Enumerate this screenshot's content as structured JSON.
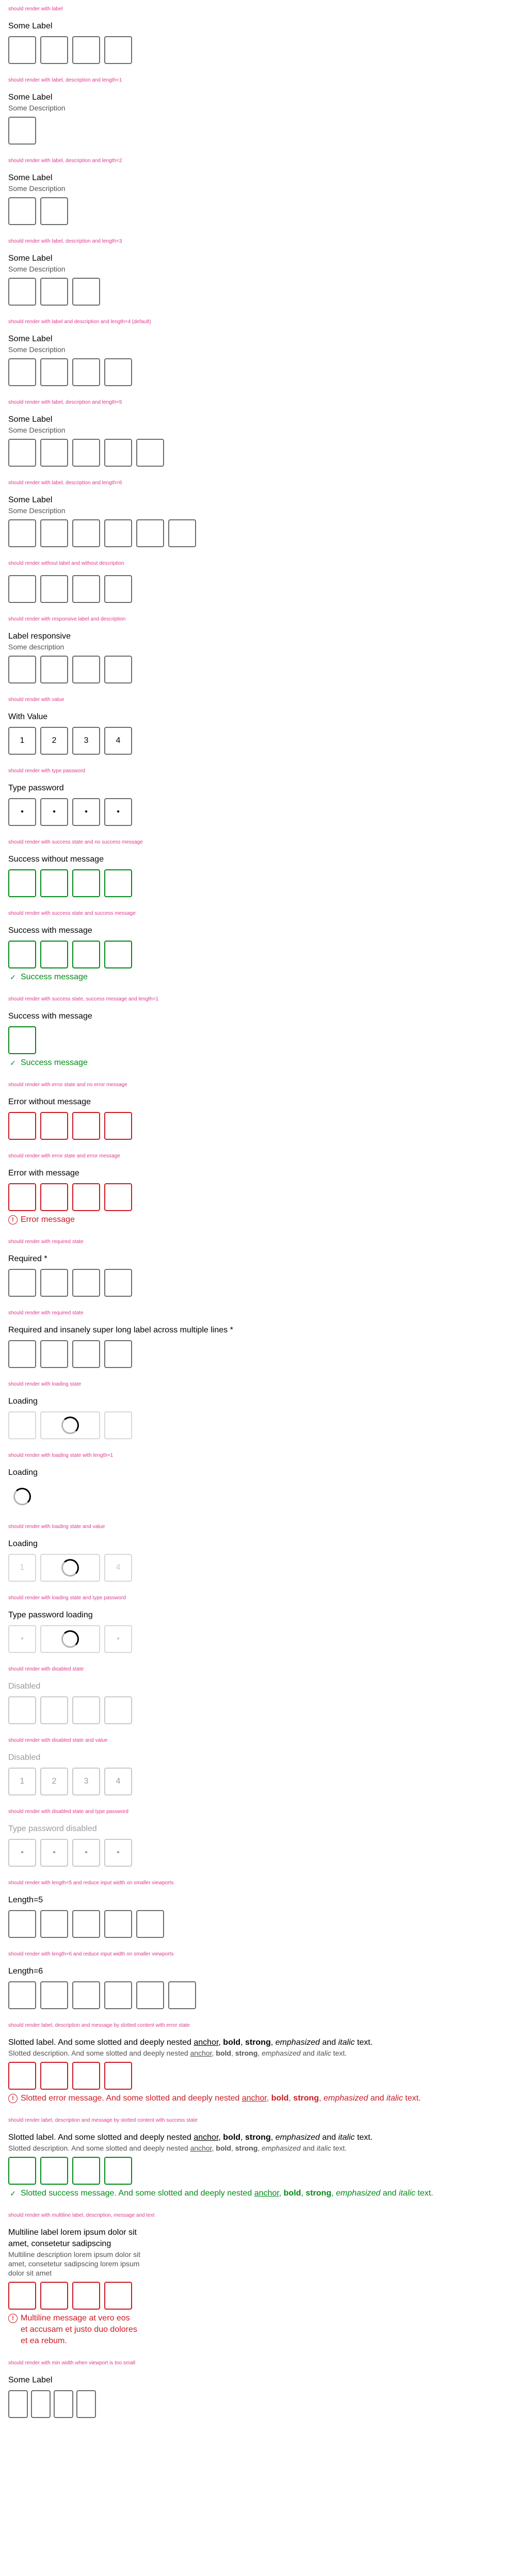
{
  "cases": {
    "c1": {
      "title": "should render with label",
      "label": "Some Label"
    },
    "c2": {
      "title": "should render with label, description and length=1",
      "label": "Some Label",
      "desc": "Some Description"
    },
    "c3": {
      "title": "should render with label, description and length=2",
      "label": "Some Label",
      "desc": "Some Description"
    },
    "c4": {
      "title": "should render with label, description and length=3",
      "label": "Some Label",
      "desc": "Some Description"
    },
    "c5": {
      "title": "should render with label and description and length=4 (default)",
      "label": "Some Label",
      "desc": "Some Description"
    },
    "c6": {
      "title": "should render with label, description and length=5",
      "label": "Some Label",
      "desc": "Some Description"
    },
    "c7": {
      "title": "should render with label, description and length=6",
      "label": "Some Label",
      "desc": "Some Description"
    },
    "c8": {
      "title": "should render without label and without description"
    },
    "c9": {
      "title": "should render with responsive label and description",
      "label": "Label responsive",
      "desc": "Some description"
    },
    "c10": {
      "title": "should render with value",
      "label": "With Value",
      "values": [
        "1",
        "2",
        "3",
        "4"
      ]
    },
    "c11": {
      "title": "should render with type password",
      "label": "Type password",
      "values": [
        "•",
        "•",
        "•",
        "•"
      ]
    },
    "c12": {
      "title": "should render with success state and no success message",
      "label": "Success without message"
    },
    "c13": {
      "title": "should render with success state and success message",
      "label": "Success with message",
      "message": "Success message"
    },
    "c14": {
      "title": "should render with success state, success message and length=1",
      "label": "Success with message",
      "message": "Success message"
    },
    "c15": {
      "title": "should render with error state and no error message",
      "label": "Error without message"
    },
    "c16": {
      "title": "should render with error state and error message",
      "label": "Error with message",
      "message": "Error message"
    },
    "c17": {
      "title": "should render with required state",
      "label": "Required *"
    },
    "c18": {
      "title": "should render with required state",
      "label": "Required and insanely super long label across multiple lines *"
    },
    "c19": {
      "title": "should render with loading state",
      "label": "Loading"
    },
    "c20": {
      "title": "should render with loading state with length=1",
      "label": "Loading"
    },
    "c21": {
      "title": "should render with loading state and value",
      "label": "Loading",
      "values": [
        "1",
        "",
        "3",
        "4"
      ]
    },
    "c22": {
      "title": "should render with loading state and type password",
      "label": "Type password loading",
      "values": [
        "•",
        "",
        "•",
        "•"
      ]
    },
    "c23": {
      "title": "should render with disabled state",
      "label": "Disabled"
    },
    "c24": {
      "title": "should render with disabled state and value",
      "label": "Disabled",
      "values": [
        "1",
        "2",
        "3",
        "4"
      ]
    },
    "c25": {
      "title": "should render with disabled state and type password",
      "label": "Type password disabled",
      "values": [
        "•",
        "•",
        "•",
        "•"
      ]
    },
    "c26": {
      "title": "should render with length=5 and reduce input width on smaller viewports",
      "label": "Length=5"
    },
    "c27": {
      "title": "should render with length=6 and reduce input width on smaller viewports",
      "label": "Length=6"
    },
    "c28": {
      "title": "should render label, description and message by slotted content with error state",
      "label_parts": {
        "a": "Slotted label. And some slotted and deeply nested ",
        "anchor": "anchor",
        "b": ", ",
        "bold": "bold",
        "c": ", ",
        "strong": "strong",
        "d": ", ",
        "em": "emphasized",
        "e": " and ",
        "i": "italic",
        "f": " text."
      },
      "desc_parts": {
        "a": "Slotted description. And some slotted and deeply nested ",
        "anchor": "anchor",
        "b": ", ",
        "bold": "bold",
        "c": ", ",
        "strong": "strong",
        "d": ", ",
        "em": "emphasized",
        "e": " and ",
        "i": "italic",
        "f": " text."
      },
      "msg_parts": {
        "a": "Slotted error message. And some slotted and deeply nested ",
        "anchor": "anchor",
        "b": ", ",
        "bold": "bold",
        "c": ", ",
        "strong": "strong",
        "d": ", ",
        "em": "emphasized",
        "e": " and ",
        "i": "italic",
        "f": " text."
      }
    },
    "c29": {
      "title": "should render label, description and message by slotted content with success state",
      "label_parts": {
        "a": "Slotted label. And some slotted and deeply nested ",
        "anchor": "anchor",
        "b": ", ",
        "bold": "bold",
        "c": ", ",
        "strong": "strong",
        "d": ", ",
        "em": "emphasized",
        "e": " and ",
        "i": "italic",
        "f": " text."
      },
      "desc_parts": {
        "a": "Slotted description. And some slotted and deeply nested ",
        "anchor": "anchor",
        "b": ", ",
        "bold": "bold",
        "c": ", ",
        "strong": "strong",
        "d": ", ",
        "em": "emphasized",
        "e": " and ",
        "i": "italic",
        "f": " text."
      },
      "msg_parts": {
        "a": "Slotted success message. And some slotted and deeply nested ",
        "anchor": "anchor",
        "b": ", ",
        "bold": "bold",
        "c": ", ",
        "strong": "strong",
        "d": ", ",
        "em": "emphasized",
        "e": " and ",
        "i": "italic",
        "f": " text."
      }
    },
    "c30": {
      "title": "should render with multiline label, description, message and text",
      "label": "Multiline label lorem ipsum dolor sit amet, consetetur sadipscing",
      "desc": "Multiline description lorem ipsum dolor sit amet, consetetur sadipscing lorem ipsum dolor sit amet",
      "message": "Multiline message at vero eos et accusam et justo duo dolores et ea rebum."
    },
    "c31": {
      "title": "should render with min width when viewport is too small",
      "label": "Some Label"
    }
  },
  "colors": {
    "title": "#de3b8b",
    "success": "#018a16",
    "error": "#cc1922",
    "border": "#6b6d70"
  },
  "icons": {
    "success": "check-icon",
    "error": "exclamation-circle-icon"
  }
}
